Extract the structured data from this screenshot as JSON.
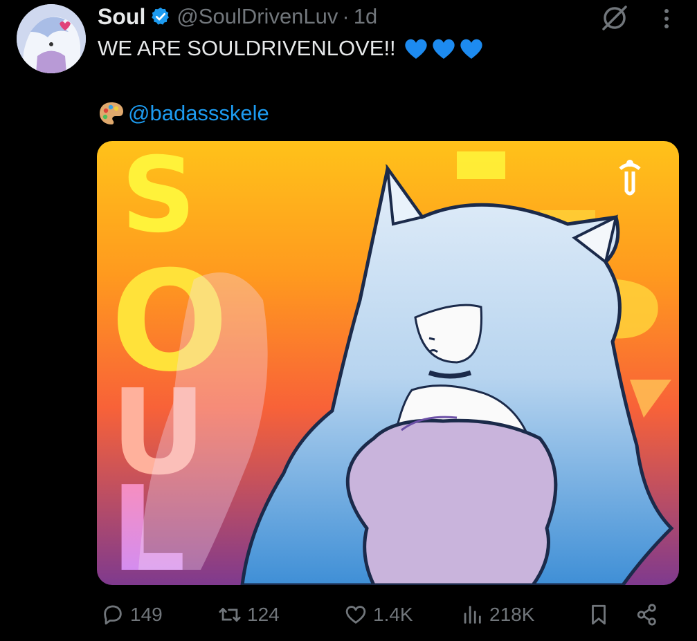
{
  "tweet": {
    "display_name": "Soul",
    "handle": "@SoulDrivenLuv",
    "separator": "·",
    "time": "1d",
    "text": "WE ARE SOULDRIVENLOVE!!",
    "emoji_hearts": [
      "blue-heart",
      "blue-heart",
      "blue-heart"
    ],
    "credit_emoji": "artist-palette",
    "credit_mention": "@badassskele"
  },
  "media": {
    "letters": [
      "S",
      "O",
      "U",
      "L"
    ]
  },
  "actions": {
    "replies": "149",
    "retweets": "124",
    "likes": "1.4K",
    "views": "218K"
  },
  "colors": {
    "background": "#000000",
    "text": "#e7e9ea",
    "muted": "#71767b",
    "accent": "#1d9bf0",
    "verified": "#1d9bf0",
    "heart": "#1d8bf0"
  }
}
